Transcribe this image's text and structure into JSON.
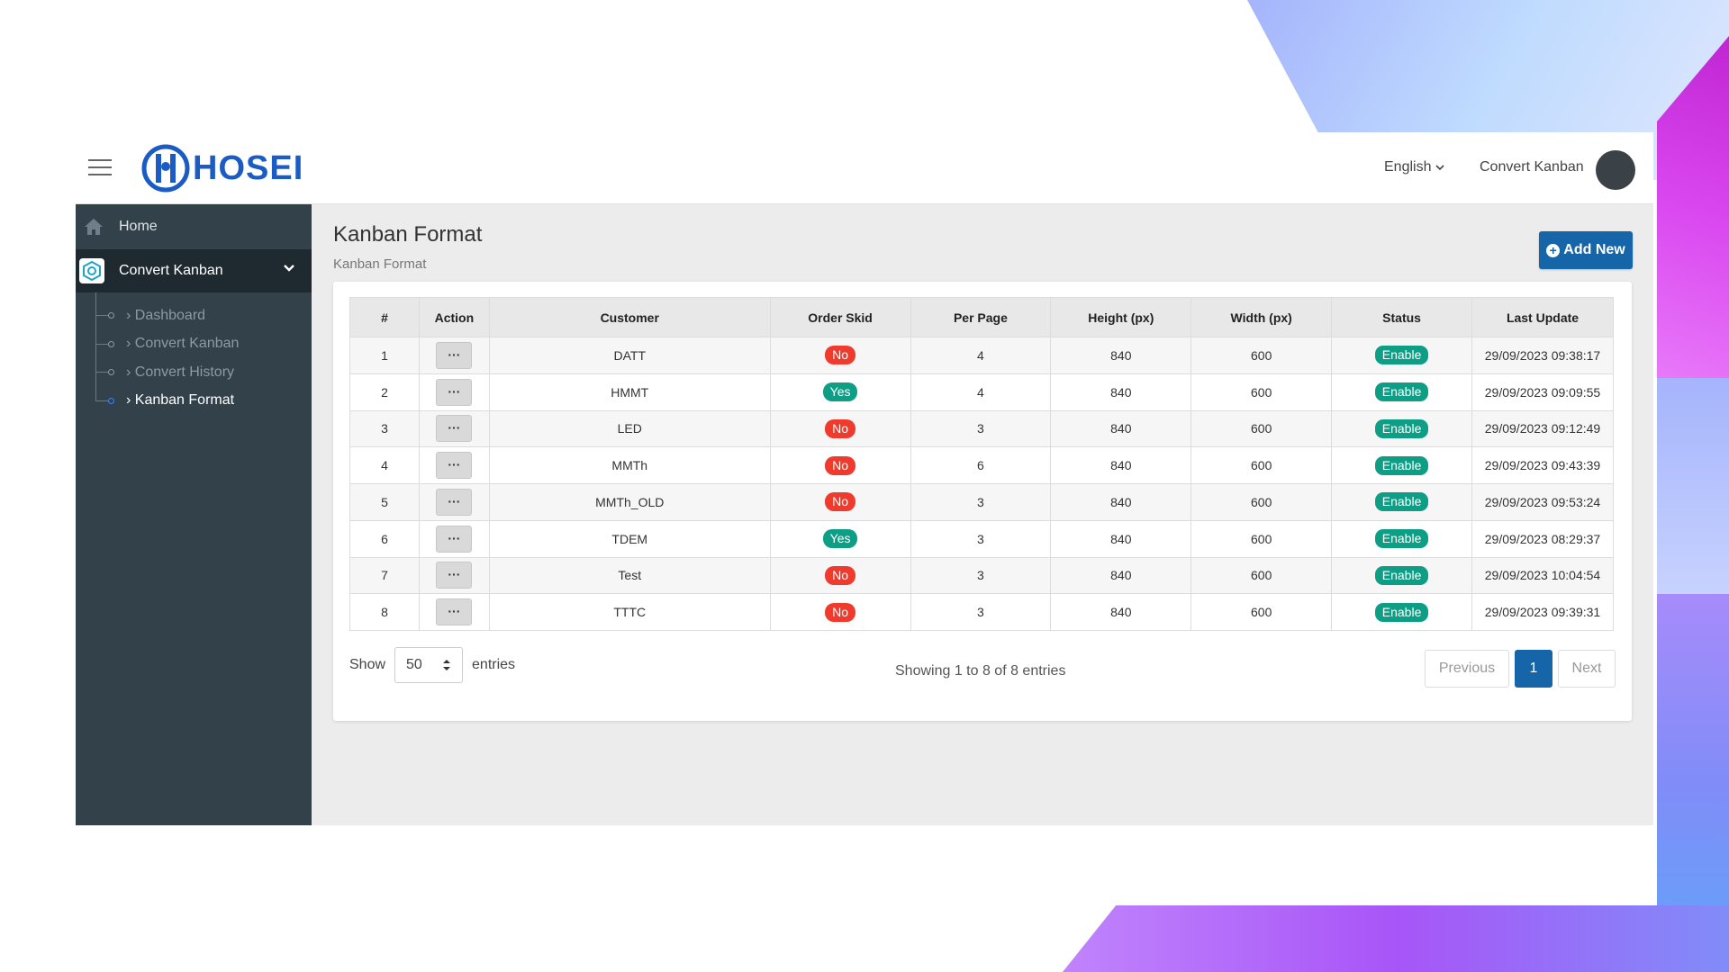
{
  "colors": {
    "primary": "#1565a8",
    "sidebar_bg": "#33414a",
    "sidebar_active_bg": "#1f2a30",
    "status_no": "#ef3b2d",
    "status_yes": "#0e9e86"
  },
  "header": {
    "logo_text": "HOSEI",
    "language": "English",
    "user_name": "Convert Kanban"
  },
  "sidebar": {
    "home_label": "Home",
    "section_label": "Convert Kanban",
    "items": [
      {
        "label": "Dashboard"
      },
      {
        "label": "Convert Kanban"
      },
      {
        "label": "Convert History"
      },
      {
        "label": "Kanban Format"
      }
    ]
  },
  "main": {
    "title": "Kanban Format",
    "breadcrumb": "Kanban Format",
    "add_button": "Add New"
  },
  "table": {
    "columns": [
      "#",
      "Action",
      "Customer",
      "Order Skid",
      "Per Page",
      "Height (px)",
      "Width (px)",
      "Status",
      "Last Update"
    ],
    "action_label": "···",
    "rows": [
      {
        "no": "1",
        "customer": "DATT",
        "order_skid": "No",
        "per_page": "4",
        "height": "840",
        "width": "600",
        "status": "Enable",
        "last_update": "29/09/2023 09:38:17"
      },
      {
        "no": "2",
        "customer": "HMMT",
        "order_skid": "Yes",
        "per_page": "4",
        "height": "840",
        "width": "600",
        "status": "Enable",
        "last_update": "29/09/2023 09:09:55"
      },
      {
        "no": "3",
        "customer": "LED",
        "order_skid": "No",
        "per_page": "3",
        "height": "840",
        "width": "600",
        "status": "Enable",
        "last_update": "29/09/2023 09:12:49"
      },
      {
        "no": "4",
        "customer": "MMTh",
        "order_skid": "No",
        "per_page": "6",
        "height": "840",
        "width": "600",
        "status": "Enable",
        "last_update": "29/09/2023 09:43:39"
      },
      {
        "no": "5",
        "customer": "MMTh_OLD",
        "order_skid": "No",
        "per_page": "3",
        "height": "840",
        "width": "600",
        "status": "Enable",
        "last_update": "29/09/2023 09:53:24"
      },
      {
        "no": "6",
        "customer": "TDEM",
        "order_skid": "Yes",
        "per_page": "3",
        "height": "840",
        "width": "600",
        "status": "Enable",
        "last_update": "29/09/2023 08:29:37"
      },
      {
        "no": "7",
        "customer": "Test",
        "order_skid": "No",
        "per_page": "3",
        "height": "840",
        "width": "600",
        "status": "Enable",
        "last_update": "29/09/2023 10:04:54"
      },
      {
        "no": "8",
        "customer": "TTTC",
        "order_skid": "No",
        "per_page": "3",
        "height": "840",
        "width": "600",
        "status": "Enable",
        "last_update": "29/09/2023 09:39:31"
      }
    ]
  },
  "footer": {
    "show_label": "Show",
    "entries_value": "50",
    "entries_label": "entries",
    "info": "Showing 1 to 8 of 8 entries",
    "prev_label": "Previous",
    "current_page": "1",
    "next_label": "Next"
  }
}
